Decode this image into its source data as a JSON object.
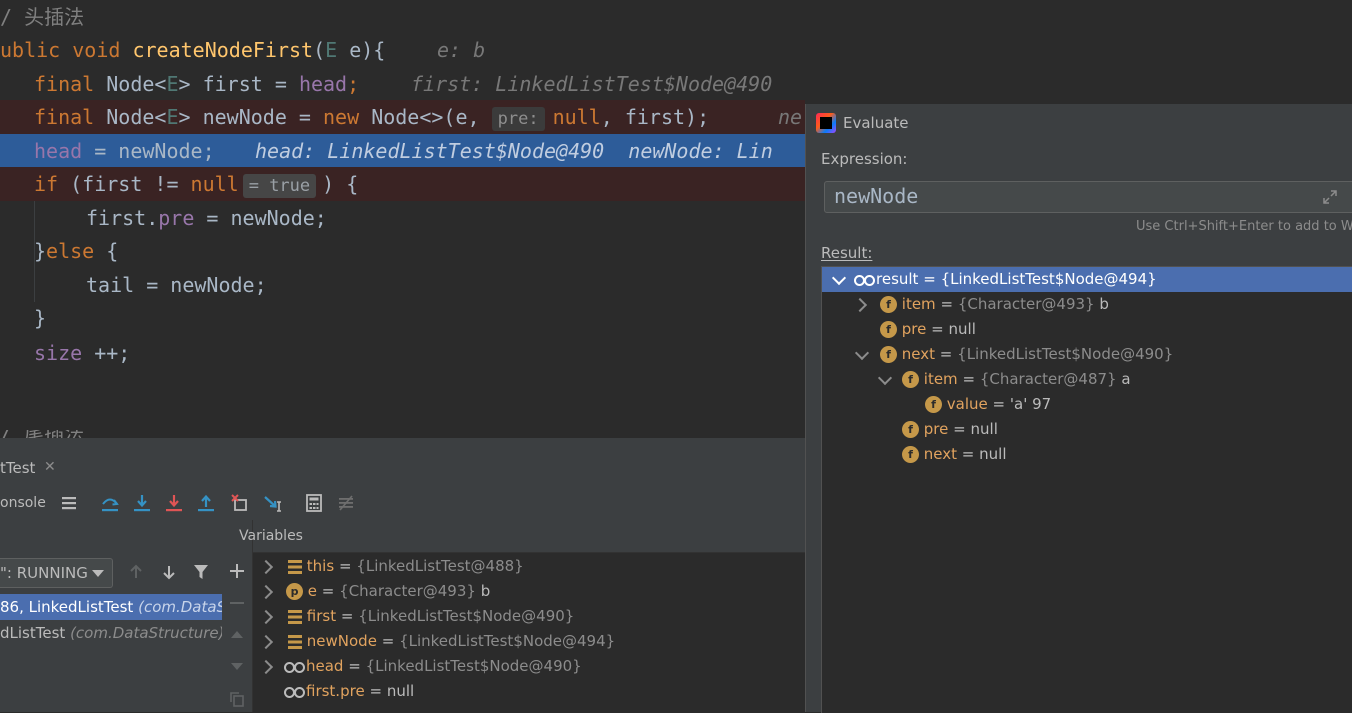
{
  "editor": {
    "lines": [
      {
        "comment": "/ 头插法"
      },
      {
        "pre": "ublic",
        "kw": " void ",
        "fn": "createNodeFirst",
        "paren": "(",
        "type": "E",
        "rest": " e){",
        "hint": "e: b"
      },
      {
        "kw": "final ",
        "t1": "Node<",
        "type": "E",
        "t2": "> first = ",
        "fld": "head",
        "semi": ";",
        "hint": "first: LinkedListTest$Node@490"
      },
      {
        "kw": "final ",
        "t1": "Node<",
        "type": "E",
        "t2": "> newNode = ",
        "kw2": "new ",
        "t3": "Node<>(e, ",
        "param_hint": "pre:",
        "kw3": "null",
        "t4": ", first);",
        "hint": "ne"
      },
      {
        "fld": "head",
        "t1": " = newNode;",
        "hint": "head: LinkedListTest$Node@490  newNode: Lin"
      },
      {
        "kw": "if ",
        "t1": "(first != ",
        "kw2": "null",
        "inline_val": "= true",
        "t2": ") {"
      },
      {
        "t1": "first.",
        "fld": "pre",
        "t2": " = newNode;"
      },
      {
        "t1": "}",
        "kw": "else",
        "t2": " {"
      },
      {
        "t1": "tail = newNode;"
      },
      {
        "t1": "}"
      },
      {
        "fld": "size",
        "t1": " ++;"
      },
      {
        "comment": "/ 尾插法"
      }
    ]
  },
  "debug_panel": {
    "tab_label": "tTest",
    "toolbar_label": "onsole",
    "thread_selector": "\": RUNNING",
    "frames": [
      {
        "text": "86, LinkedListTest ",
        "pkg": "(com.DataS"
      },
      {
        "text": "dListTest ",
        "pkg": "(com.DataStructure)"
      }
    ],
    "variables_title": "Variables",
    "variables": [
      {
        "name": "this",
        "type": "{LinkedListTest@488}",
        "value": "",
        "icon": "list-icon"
      },
      {
        "name": "e",
        "type": "{Character@493}",
        "value": "b",
        "icon": "param-icon"
      },
      {
        "name": "first",
        "type": "{LinkedListTest$Node@490}",
        "value": "",
        "icon": "list-icon"
      },
      {
        "name": "newNode",
        "type": "{LinkedListTest$Node@494}",
        "value": "",
        "icon": "list-icon"
      },
      {
        "name": "head",
        "type": "{LinkedListTest$Node@490}",
        "value": "",
        "icon": "watch-icon"
      },
      {
        "name": "first.pre",
        "type": "",
        "value": "null",
        "icon": "watch-icon"
      }
    ]
  },
  "evaluate": {
    "title": "Evaluate",
    "expression_label": "Expression:",
    "expression": "newNode",
    "hint": "Use Ctrl+Shift+Enter to add to Wat",
    "result_label": "Result:",
    "tree": [
      {
        "name": "result",
        "type": "{LinkedListTest$Node@494}",
        "value": "",
        "icon": "watch-icon",
        "level": 0,
        "expanded": true
      },
      {
        "name": "item",
        "type": "{Character@493}",
        "value": "b",
        "icon": "field-icon",
        "level": 1,
        "expandable": true
      },
      {
        "name": "pre",
        "type": "",
        "value": "null",
        "icon": "field-icon",
        "level": 1
      },
      {
        "name": "next",
        "type": "{LinkedListTest$Node@490}",
        "value": "",
        "icon": "field-icon",
        "level": 1,
        "expanded": true
      },
      {
        "name": "item",
        "type": "{Character@487}",
        "value": "a",
        "icon": "field-icon",
        "level": 2,
        "expanded": true
      },
      {
        "name": "value",
        "type": "",
        "value": "'a' 97",
        "icon": "field-icon",
        "level": 3
      },
      {
        "name": "pre",
        "type": "",
        "value": "null",
        "icon": "field-icon",
        "level": 2
      },
      {
        "name": "next",
        "type": "",
        "value": "null",
        "icon": "field-icon",
        "level": 2
      }
    ]
  }
}
